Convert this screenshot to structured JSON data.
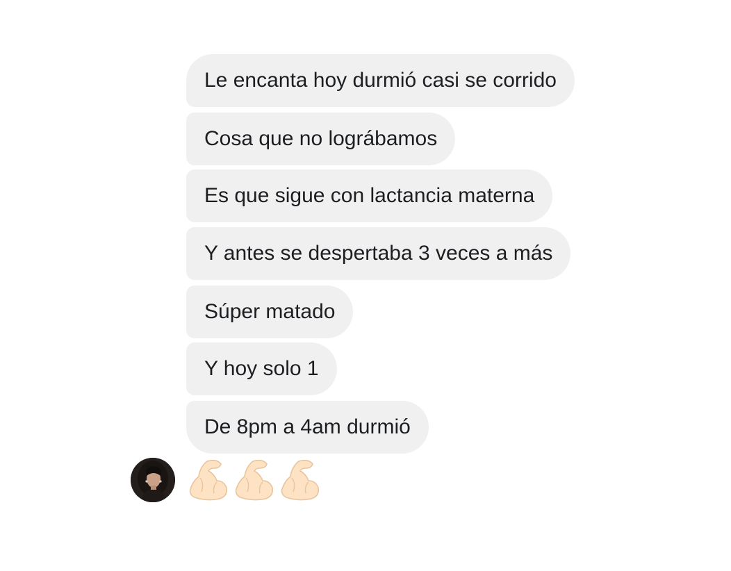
{
  "thread": {
    "messages": [
      {
        "text": "Le encanta hoy durmió casi se corrido"
      },
      {
        "text": "Cosa que no lográbamos"
      },
      {
        "text": "Es que sigue con lactancia materna"
      },
      {
        "text": "Y antes se despertaba 3 veces a más"
      },
      {
        "text": "Súper matado"
      },
      {
        "text": "Y hoy solo 1"
      },
      {
        "text": "De 8pm a 4am durmió"
      }
    ],
    "reaction_message": {
      "emoji": [
        "flexed-biceps",
        "flexed-biceps",
        "flexed-biceps"
      ]
    },
    "sender": {
      "avatar_icon": "profile-photo"
    }
  },
  "colors": {
    "bubble_bg": "#f0f0f0",
    "text": "#1c1e21",
    "background": "#ffffff"
  }
}
